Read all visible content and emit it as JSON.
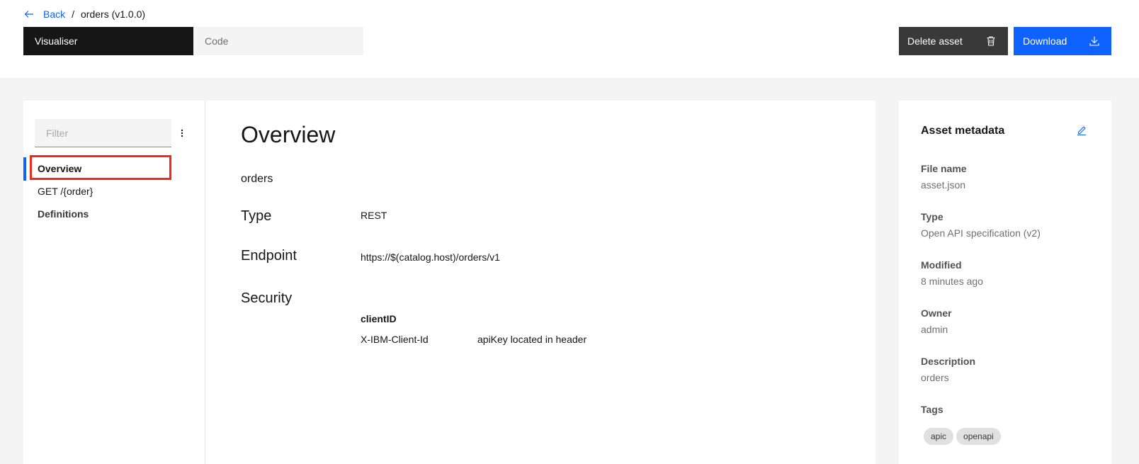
{
  "breadcrumb": {
    "back_label": "Back",
    "separator": "/",
    "current": "orders (v1.0.0)"
  },
  "view_switch": {
    "visualiser_label": "Visualiser",
    "code_label": "Code"
  },
  "actions": {
    "delete_label": "Delete asset",
    "delete_icon": "trash-icon",
    "download_label": "Download",
    "download_icon": "download-icon"
  },
  "nav": {
    "filter_placeholder": "Filter",
    "items": [
      {
        "label": "Overview",
        "active": true
      },
      {
        "label": "GET /{order}",
        "active": false
      },
      {
        "label": "Definitions",
        "active": false
      }
    ]
  },
  "overview": {
    "title": "Overview",
    "description": "orders",
    "type_label": "Type",
    "type_value": "REST",
    "endpoint_label": "Endpoint",
    "endpoint_value": "https://$(catalog.host)/orders/v1",
    "security_label": "Security",
    "security": {
      "name": "clientID",
      "header": "X-IBM-Client-Id",
      "description": "apiKey located in header"
    }
  },
  "metadata": {
    "title": "Asset metadata",
    "edit_icon": "edit-icon",
    "file_name_label": "File name",
    "file_name": "asset.json",
    "type_label": "Type",
    "type": "Open API specification (v2)",
    "modified_label": "Modified",
    "modified": "8 minutes ago",
    "owner_label": "Owner",
    "owner": "admin",
    "description_label": "Description",
    "description": "orders",
    "tags_label": "Tags",
    "tags": [
      "apic",
      "openapi"
    ]
  },
  "colors": {
    "accent": "#0f62fe",
    "highlight": "#f0291a",
    "dark": "#161616"
  }
}
